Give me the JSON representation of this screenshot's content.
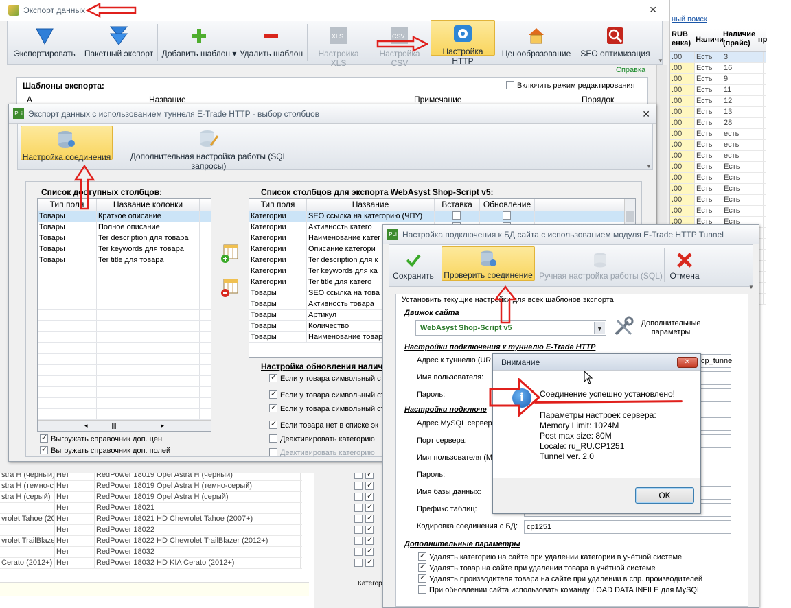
{
  "bg": {
    "search_link": "ный поиск",
    "right_headers": [
      "RUB\nенка)",
      "Наличи",
      "Наличие (прайс)",
      "пр"
    ],
    "right_rows": [
      [
        ".00",
        "Есть",
        "3"
      ],
      [
        ".00",
        "Есть",
        "16"
      ],
      [
        ".00",
        "Есть",
        "9"
      ],
      [
        ".00",
        "Есть",
        "11"
      ],
      [
        ".00",
        "Есть",
        "12"
      ],
      [
        ".00",
        "Есть",
        "13"
      ],
      [
        ".00",
        "Есть",
        "28"
      ],
      [
        ".00",
        "Есть",
        "есть"
      ],
      [
        ".00",
        "Есть",
        "есть"
      ],
      [
        ".00",
        "Есть",
        "есть"
      ],
      [
        ".00",
        "Есть",
        "Есть"
      ],
      [
        ".00",
        "Есть",
        "Есть"
      ],
      [
        ".00",
        "Есть",
        "Есть"
      ],
      [
        ".00",
        "Есть",
        "Есть"
      ],
      [
        ".00",
        "Есть",
        "Есть"
      ],
      [
        ".00",
        "Есть",
        "Есть"
      ],
      [
        ".00",
        "Есть",
        "Есть"
      ],
      [
        ".00",
        "Есть",
        "Есть"
      ],
      [
        ".00",
        "Есть",
        "Есть"
      ],
      [
        ".00",
        "Есть",
        "Есть"
      ],
      [
        ".00",
        "Есть",
        "Есть"
      ],
      [
        ".00",
        "Есть",
        "Есть"
      ],
      [
        ".00",
        "Есть",
        "Есть"
      ]
    ],
    "bottom_rows": [
      [
        "stra H (черный)",
        "Нет",
        "RedPower 18019 Opel Astra H (черный)"
      ],
      [
        "stra H (темно-сер",
        "Нет",
        "RedPower 18019 Opel Astra H (темно-серый)"
      ],
      [
        "stra H (серый)",
        "Нет",
        "RedPower 18019 Opel Astra H (серый)"
      ],
      [
        "",
        "Нет",
        "RedPower 18021"
      ],
      [
        "vrolet Tahoe (20",
        "Нет",
        "RedPower 18021 HD Chevrolet Tahoe (2007+)"
      ],
      [
        "",
        "Нет",
        "RedPower 18022"
      ],
      [
        "vrolet TrailBlazer",
        "Нет",
        "RedPower 18022 HD Chevrolet TrailBlazer (2012+)"
      ],
      [
        "",
        "Нет",
        "RedPower 18032"
      ],
      [
        "Cerato (2012+)",
        "Нет",
        "RedPower 18032 HD KIA Cerato (2012+)"
      ]
    ],
    "categ": "Категор"
  },
  "win1": {
    "title": "Экспорт данных",
    "buttons": [
      {
        "label": "Экспортировать"
      },
      {
        "label": "Пакетный экспорт"
      },
      {
        "label": "Добавить шаблон ▾"
      },
      {
        "label": "Удалить шаблон"
      },
      {
        "label": "Настройка XLS"
      },
      {
        "label": "Настройка CSV"
      },
      {
        "label": "Настройка HTTP"
      },
      {
        "label": "Ценообразование"
      },
      {
        "label": "SEO оптимизация"
      }
    ],
    "help": "Справка",
    "templates_label": "Шаблоны экспорта:",
    "edit_mode": "Включить режим редактирования",
    "cols": [
      "А",
      "Название",
      "Примечание",
      "Порядок"
    ]
  },
  "win2": {
    "title": "Экспорт данных с использованием туннеля E-Trade HTTP - выбор столбцов",
    "btn_conn": "Настройка соединения",
    "btn_sql": "Дополнительная настройка работы (SQL запросы)",
    "avail_label": "Список доступных столбцов:",
    "avail_cols": [
      "Тип поля",
      "Название колонки"
    ],
    "avail_rows": [
      [
        "Товары",
        "Краткое описание"
      ],
      [
        "Товары",
        "Полное описание"
      ],
      [
        "Товары",
        "Ter description для товара"
      ],
      [
        "Товары",
        "Ter keywords для товара"
      ],
      [
        "Товары",
        "Ter title для товара"
      ]
    ],
    "export_label": "Список столбцов для экспорта WebAsyst Shop-Script v5:",
    "export_cols": [
      "Тип поля",
      "Название",
      "Вставка",
      "Обновление"
    ],
    "export_rows": [
      [
        "Категории",
        "SEO ссылка на категорию (ЧПУ)"
      ],
      [
        "Категории",
        "Активность катего"
      ],
      [
        "Категории",
        "Наименование катег"
      ],
      [
        "Категории",
        "Описание категори"
      ],
      [
        "Категории",
        "Ter description для к"
      ],
      [
        "Категории",
        "Ter keywords для ка"
      ],
      [
        "Категории",
        "Ter title для катего"
      ],
      [
        "Товары",
        "SEO ссылка на това"
      ],
      [
        "Товары",
        "Активность товара"
      ],
      [
        "Товары",
        "Артикул"
      ],
      [
        "Товары",
        "Количество"
      ],
      [
        "Товары",
        "Наименование товар"
      ]
    ],
    "chk_prices": "Выгружать справочник доп. цен",
    "chk_fields": "Выгружать справочник доп. полей",
    "update_label": "Настройка обновления налич",
    "update_opts": [
      "Если у товара символьный ст",
      "Если у товара символьный ст",
      "Если у товара символьный ст",
      "Если товара нет в списке эк",
      "Деактивировать категорию",
      "Деактивировать категорию"
    ]
  },
  "win3": {
    "title": "Настройка подключения к БД сайта с использованием модуля E-Trade HTTP Tunnel",
    "btn_save": "Сохранить",
    "btn_check": "Проверить соединение",
    "btn_manual": "Ручная настройка работы (SQL)",
    "btn_cancel": "Отмена",
    "set_all": "Установить текущие настройки для всех шаблонов экспорта",
    "engine_label": "Движок сайта",
    "engine_value": "WebAsyst Shop-Script v5",
    "extra_params": "Дополнительные параметры",
    "tunnel_label": "Настройки подключения к туннелю E-Trade HTTP",
    "tunnel_addr": "Адрес к туннелю (URL",
    "tunnel_addr_val": "cp_tunne",
    "user": "Имя пользователя:",
    "pass": "Пароль:",
    "mysql_label": "Настройки подключе",
    "mysql_addr": "Адрес MySQL сервера",
    "port": "Порт сервера:",
    "mysql_user": "Имя пользователя (My",
    "mysql_pass": "Пароль:",
    "dbname": "Имя базы данных:",
    "prefix": "Префикс таблиц:",
    "encoding": "Кодировка соединения с БД:",
    "encoding_val": "cp1251",
    "extra_label": "Дополнительные параметры",
    "extra_opts": [
      {
        "t": "Удалять категорию на сайте при удалении категории в учётной системе",
        "on": true
      },
      {
        "t": "Удалять товар на сайте при удалении товара в учётной системе",
        "on": true
      },
      {
        "t": "Удалять производителя товара на сайте при удалении в спр. производителей",
        "on": true
      },
      {
        "t": "При обновлении сайта использовать команду LOAD DATA INFILE для MySQL",
        "on": false
      }
    ]
  },
  "dlg": {
    "title": "Внимание",
    "msg": "Соединение успешно установлено!",
    "params_title": "Параметры настроек сервера:",
    "lines": [
      "Memory Limit: 1024M",
      "Post max size: 80M",
      "Locale: ru_RU.CP1251",
      "Tunnel ver. 2.0"
    ],
    "ok": "OK"
  },
  "colors": {
    "highlight": "#f9d55e",
    "accent_red": "#e0201c",
    "selection": "#cce4f7"
  }
}
